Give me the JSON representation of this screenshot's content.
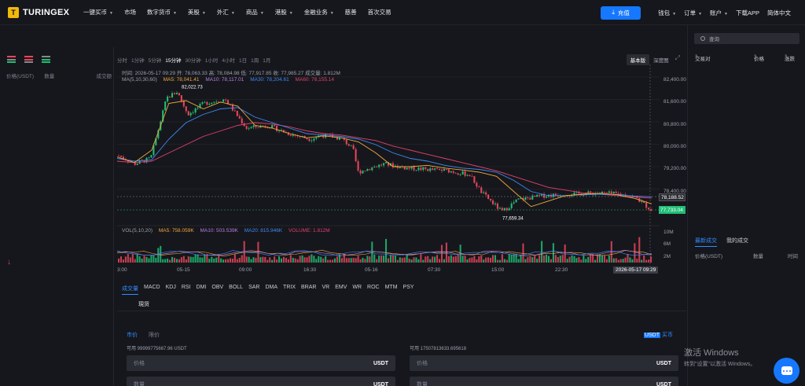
{
  "brand": {
    "name": "TURINGEX",
    "mark": "T"
  },
  "nav": {
    "items": [
      {
        "label": "一键买币",
        "caret": true
      },
      {
        "label": "市场",
        "caret": false
      },
      {
        "label": "数字货币",
        "caret": true
      },
      {
        "label": "美股",
        "caret": true
      },
      {
        "label": "外汇",
        "caret": true
      },
      {
        "label": "商品",
        "caret": true
      },
      {
        "label": "港股",
        "caret": true
      },
      {
        "label": "金融业务",
        "caret": true
      },
      {
        "label": "慈善",
        "caret": false
      },
      {
        "label": "首次交易",
        "caret": false
      }
    ],
    "deposit": "充值",
    "right": [
      {
        "label": "钱包",
        "caret": true
      },
      {
        "label": "订单",
        "caret": true
      },
      {
        "label": "账户",
        "caret": true
      },
      {
        "label": "下载APP",
        "caret": false
      },
      {
        "label": "简体中文",
        "caret": false
      }
    ]
  },
  "orderbook": {
    "headers": {
      "price": "价格(USDT)",
      "amount": "数量",
      "total": "成交额"
    }
  },
  "timeframes": [
    "分时",
    "1分钟",
    "5分钟",
    "15分钟",
    "30分钟",
    "1小时",
    "4小时",
    "1日",
    "1周",
    "1月"
  ],
  "active_timeframe": "15分钟",
  "views": {
    "basic": "基本版",
    "depth": "深度图"
  },
  "info": {
    "text": "时间: 2026-05-17 09:29   开: 78,063.33   高: 78,084.98   低: 77,917.85   收: 77,985.27   成交量: 1.812M"
  },
  "ma": {
    "label": "MA(5,10,30,60)",
    "ma5": "MA5: 78,041.41",
    "ma10": "MA10: 78,117.01",
    "ma30": "MA30: 78,204.61",
    "ma60": "MA60: 78,155.14",
    "colors": {
      "ma5": "#f2a93b",
      "ma10": "#b57ee0",
      "ma30": "#3d8af7",
      "ma60": "#e0416e"
    }
  },
  "vol": {
    "label": "VOL(5,10,20)",
    "ma5": "MA5: 758.059K",
    "ma10": "MA10: 503.539K",
    "ma20": "MA20: 815.946K",
    "volume": "VOLUME: 1.812M"
  },
  "price_axis": [
    "82,400.00",
    "81,600.00",
    "80,800.00",
    "80,000.00",
    "79,200.00",
    "78,400.00"
  ],
  "vol_axis": [
    "10M",
    "6M",
    "2M"
  ],
  "price_tags": {
    "ma_price": "78,188.52",
    "last": "77,733.04"
  },
  "annotations": {
    "high": "82,022.73",
    "low": "77,659.34"
  },
  "time_axis": [
    "3:00",
    "05-15",
    "09:00",
    "16:30",
    "05-16",
    "07:30",
    "15:00",
    "22:30"
  ],
  "crosshair_time": "2026-05-17 09:29",
  "indicators": [
    "成交量",
    "MACD",
    "KDJ",
    "RSI",
    "DMI",
    "OBV",
    "BOLL",
    "SAR",
    "DMA",
    "TRIX",
    "BRAR",
    "VR",
    "EMV",
    "WR",
    "ROC",
    "MTM",
    "PSY"
  ],
  "active_indicator": "成交量",
  "spot_label": "現货",
  "trade": {
    "tabs": [
      "市价",
      "限价"
    ],
    "active_tab": "市价",
    "currency_tabs": {
      "active": "USDT",
      "other": "买币"
    },
    "left": {
      "available": "可用   99999775667.96 USDT",
      "price_placeholder": "价格",
      "amount_placeholder": "数量",
      "unit": "USDT"
    },
    "right": {
      "available": "可用   17507813633.695618",
      "price_placeholder": "价格",
      "amount_placeholder": "数量",
      "unit": "USDT"
    }
  },
  "market": {
    "search_placeholder": "查询",
    "headers": {
      "pair": "交易对",
      "price": "价格",
      "change": "涨跌"
    }
  },
  "trades": {
    "tabs": [
      "最新成交",
      "我的成交"
    ],
    "active_tab": "最新成交",
    "headers": {
      "price": "价格(USDT)",
      "amount": "数量",
      "time": "时间"
    }
  },
  "watermark": {
    "line1": "激活 Windows",
    "line2": "转到\"设置\"以激活 Windows。"
  },
  "colors": {
    "up": "#1fbf75",
    "down": "#e8455b",
    "accent": "#1678ff",
    "bg": "#16171c"
  },
  "chart_data": {
    "type": "candlestick",
    "timeframe": "15m",
    "price_range": [
      77659.34,
      82022.73
    ],
    "path": [
      [
        0,
        79700
      ],
      [
        0.03,
        79400
      ],
      [
        0.06,
        79600
      ],
      [
        0.09,
        81800
      ],
      [
        0.11,
        82022.73
      ],
      [
        0.13,
        81200
      ],
      [
        0.16,
        81600
      ],
      [
        0.2,
        81750
      ],
      [
        0.24,
        80700
      ],
      [
        0.28,
        80800
      ],
      [
        0.32,
        80500
      ],
      [
        0.36,
        80300
      ],
      [
        0.38,
        80450
      ],
      [
        0.4,
        80400
      ],
      [
        0.42,
        80300
      ],
      [
        0.44,
        79950
      ],
      [
        0.45,
        79100
      ],
      [
        0.48,
        79300
      ],
      [
        0.5,
        79400
      ],
      [
        0.54,
        79250
      ],
      [
        0.58,
        79200
      ],
      [
        0.62,
        79150
      ],
      [
        0.66,
        79000
      ],
      [
        0.68,
        78400
      ],
      [
        0.72,
        77659.34
      ],
      [
        0.75,
        78100
      ],
      [
        0.8,
        78250
      ],
      [
        0.85,
        78300
      ],
      [
        0.9,
        78350
      ],
      [
        0.94,
        78300
      ],
      [
        0.97,
        78200
      ],
      [
        1.0,
        77733.04
      ]
    ],
    "ma5": [
      79650,
      79450,
      79900,
      81600,
      81700,
      81400,
      81650,
      81500,
      80800,
      80700,
      80500,
      80350,
      80420,
      80350,
      80200,
      79800,
      79300,
      79300,
      79350,
      79250,
      79180,
      79100,
      78950,
      78400,
      77850,
      78050,
      78250,
      78300,
      78330,
      78280,
      78150,
      77950
    ],
    "ma30": [
      79600,
      79500,
      79550,
      80300,
      80900,
      81200,
      81400,
      81450,
      81100,
      80900,
      80700,
      80500,
      80450,
      80400,
      80300,
      80100,
      79800,
      79600,
      79500,
      79350,
      79250,
      79200,
      79100,
      78800,
      78400,
      78250,
      78250,
      78280,
      78300,
      78290,
      78230,
      78204.61
    ],
    "ma60": [
      79500,
      79450,
      79500,
      79800,
      80100,
      80400,
      80600,
      80800,
      80900,
      80850,
      80750,
      80600,
      80500,
      80450,
      80350,
      80250,
      80050,
      79900,
      79750,
      79600,
      79450,
      79300,
      79150,
      78950,
      78750,
      78550,
      78450,
      78350,
      78300,
      78250,
      78200,
      78155.14
    ]
  }
}
